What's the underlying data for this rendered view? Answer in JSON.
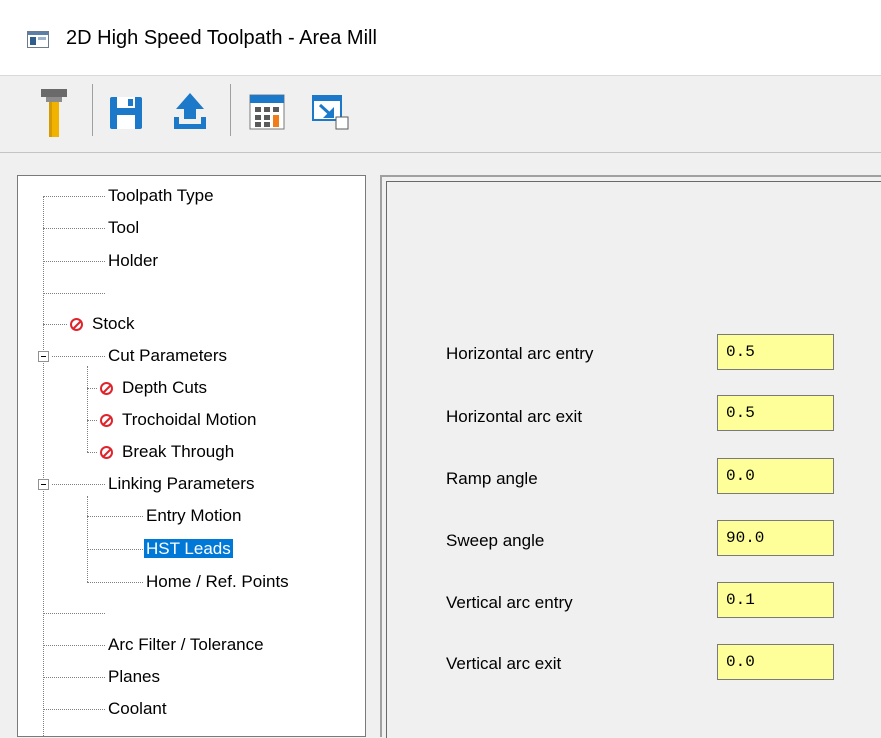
{
  "window": {
    "title": "2D High Speed Toolpath - Area Mill"
  },
  "toolbar": {
    "buttons": [
      "tool-icon",
      "save-icon",
      "upload-icon",
      "calculator-icon",
      "minimize-to-graphics-icon"
    ]
  },
  "tree": {
    "items": [
      {
        "label": "Toolpath Type"
      },
      {
        "label": "Tool"
      },
      {
        "label": "Holder"
      },
      {
        "label": ""
      },
      {
        "label": "Stock"
      },
      {
        "label": "Cut Parameters"
      },
      {
        "label": "Depth Cuts"
      },
      {
        "label": "Trochoidal Motion"
      },
      {
        "label": "Break Through"
      },
      {
        "label": "Linking Parameters"
      },
      {
        "label": "Entry Motion"
      },
      {
        "label": "HST Leads"
      },
      {
        "label": "Home / Ref. Points"
      },
      {
        "label": ""
      },
      {
        "label": "Arc Filter / Tolerance"
      },
      {
        "label": "Planes"
      },
      {
        "label": "Coolant"
      }
    ]
  },
  "fields": [
    {
      "label": "Horizontal arc entry",
      "value": "0.5"
    },
    {
      "label": "Horizontal arc exit",
      "value": "0.5"
    },
    {
      "label": "Ramp angle",
      "value": "0.0"
    },
    {
      "label": "Sweep angle",
      "value": "90.0"
    },
    {
      "label": "Vertical arc entry",
      "value": "0.1"
    },
    {
      "label": "Vertical arc exit",
      "value": "0.0"
    }
  ],
  "colors": {
    "input_bg": "#ffff99",
    "selection": "#0078d7",
    "error_icon": "#e0242c"
  }
}
